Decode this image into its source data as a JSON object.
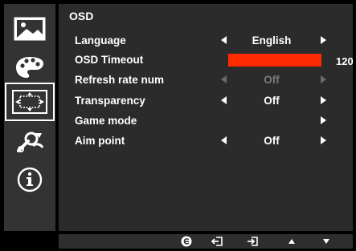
{
  "menu": {
    "title": "OSD",
    "rows": [
      {
        "label": "Language",
        "value": "English"
      },
      {
        "label": "OSD Timeout",
        "value": "120",
        "progress": 1.0
      },
      {
        "label": "Refresh rate num",
        "value": "Off"
      },
      {
        "label": "Transparency",
        "value": "Off"
      },
      {
        "label": "Game mode",
        "value": ""
      },
      {
        "label": "Aim point",
        "value": "Off"
      }
    ]
  },
  "sidebar": {
    "items": [
      {
        "icon": "picture-icon"
      },
      {
        "icon": "color-palette-icon"
      },
      {
        "icon": "osd-position-icon",
        "selected": true
      },
      {
        "icon": "settings-wrench-icon"
      },
      {
        "icon": "info-icon"
      }
    ]
  },
  "bottombar": {
    "buttons": [
      {
        "icon": "empowering-e-icon"
      },
      {
        "icon": "exit-icon"
      },
      {
        "icon": "enter-icon"
      },
      {
        "icon": "up-arrow-icon"
      },
      {
        "icon": "down-arrow-icon"
      }
    ]
  },
  "colors": {
    "progress_fill": "#ff2a00",
    "panel": "#2b2b2b",
    "sidebar": "#333333",
    "disabled_text": "#7a7a7a"
  }
}
